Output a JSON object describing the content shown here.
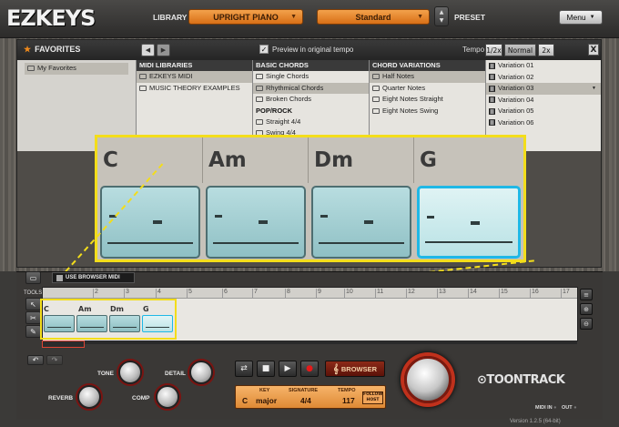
{
  "topbar": {
    "logo": "EZKEYS",
    "library_label": "LIBRARY",
    "library_value": "UPRIGHT PIANO",
    "preset_value": "Standard",
    "preset_label": "PRESET",
    "menu_label": "Menu"
  },
  "browser": {
    "favorites_title": "FAVORITES",
    "preview_label": "Preview in original tempo",
    "tempo_label": "Tempo",
    "tempo_options": [
      "1/2x",
      "Normal",
      "2x"
    ],
    "tempo_selected": "Normal",
    "close": "X",
    "favorites_items": [
      "My Favorites"
    ],
    "midi_libraries": {
      "header": "MIDI LIBRARIES",
      "items": [
        "EZKEYS MIDI",
        "MUSIC THEORY EXAMPLES"
      ]
    },
    "basic_chords": {
      "header": "BASIC CHORDS",
      "items": [
        "Single Chords",
        "Rhythmical Chords",
        "Broken Chords"
      ],
      "subheader": "POP/ROCK",
      "sub_items": [
        "Straight 4/4",
        "Swing 4/4"
      ]
    },
    "chord_variations": {
      "header": "CHORD VARIATIONS",
      "items": [
        "Half Notes",
        "Quarter Notes",
        "Eight Notes Straight",
        "Eight Notes Swing"
      ]
    },
    "variations": [
      "Variation 01",
      "Variation 02",
      "Variation 03",
      "Variation 04",
      "Variation 05",
      "Variation 06"
    ]
  },
  "zoom": {
    "chords": [
      "C",
      "Am",
      "Dm",
      "G"
    ]
  },
  "device": {
    "tools_label": "TOOLS",
    "use_browser_label": "USE BROWSER MIDI",
    "ruler": [
      "2",
      "3",
      "4",
      "5",
      "6",
      "7",
      "8",
      "9",
      "10",
      "11",
      "12",
      "13",
      "14",
      "15",
      "16",
      "17"
    ],
    "track_chords": [
      "C",
      "Am",
      "Dm",
      "G"
    ],
    "knobs": {
      "tone": "TONE",
      "detail": "DETAIL",
      "reverb": "REVERB",
      "comp": "COMP"
    },
    "browser_button": "BROWSER",
    "lcd": {
      "key_label": "KEY",
      "signature_label": "SIGNATURE",
      "tempo_label": "TEMPO",
      "key_root": "C",
      "key_mode": "major",
      "signature": "4/4",
      "tempo": "117",
      "follow_host": "FOLLOW HOST"
    },
    "brand": "TOONTRACK",
    "midi_in": "MIDI IN",
    "midi_out": "OUT",
    "version": "Version 1.2.5 (64-bit)"
  },
  "colors": {
    "accent": "#e07a1f",
    "highlight": "#f3dd1b",
    "chord_block": "#a4d0d4",
    "selected": "#1fb8e6"
  }
}
